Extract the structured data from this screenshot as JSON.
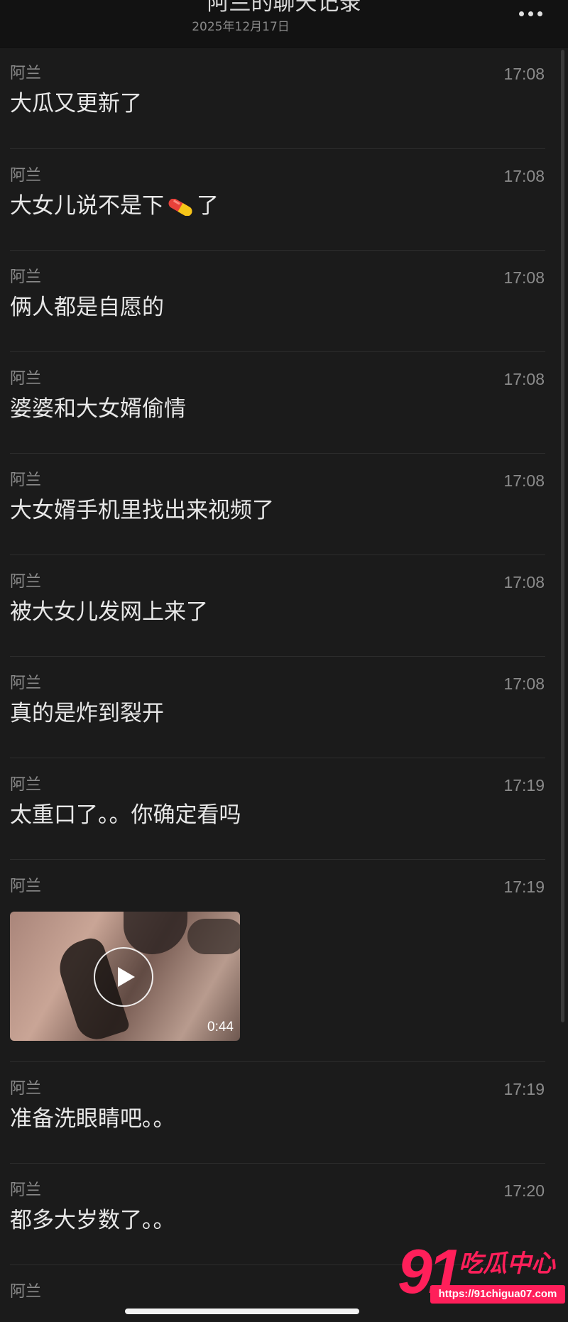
{
  "header": {
    "title": "阿兰的聊天记录",
    "date": "2025年12月17日",
    "more_icon": "more-dots-icon"
  },
  "messages": [
    {
      "sender": "阿兰",
      "time": "17:08",
      "text": "大瓜又更新了"
    },
    {
      "sender": "阿兰",
      "time": "17:08",
      "text_before": "大女儿说不是下",
      "emoji": "pill-emoji",
      "text_after": "了"
    },
    {
      "sender": "阿兰",
      "time": "17:08",
      "text": "俩人都是自愿的"
    },
    {
      "sender": "阿兰",
      "time": "17:08",
      "text": "婆婆和大女婿偷情"
    },
    {
      "sender": "阿兰",
      "time": "17:08",
      "text": "大女婿手机里找出来视频了"
    },
    {
      "sender": "阿兰",
      "time": "17:08",
      "text": "被大女儿发网上来了"
    },
    {
      "sender": "阿兰",
      "time": "17:08",
      "text": "真的是炸到裂开"
    },
    {
      "sender": "阿兰",
      "time": "17:19",
      "text": "太重口了。。你确定看吗"
    },
    {
      "sender": "阿兰",
      "time": "17:19",
      "video": {
        "duration": "0:44",
        "icon": "play-icon"
      }
    },
    {
      "sender": "阿兰",
      "time": "17:19",
      "text": "准备洗眼睛吧。。"
    },
    {
      "sender": "阿兰",
      "time": "17:20",
      "text": "都多大岁数了。。"
    },
    {
      "sender": "阿兰"
    }
  ],
  "watermark": {
    "number": "91",
    "brand": "吃瓜中心",
    "url": "https://91chigua07.com",
    "color": "#ff1f5a"
  },
  "colors": {
    "background": "#1b1b1b",
    "header": "#121212",
    "text": "#e8e8e8",
    "muted": "#8b8b8b"
  }
}
